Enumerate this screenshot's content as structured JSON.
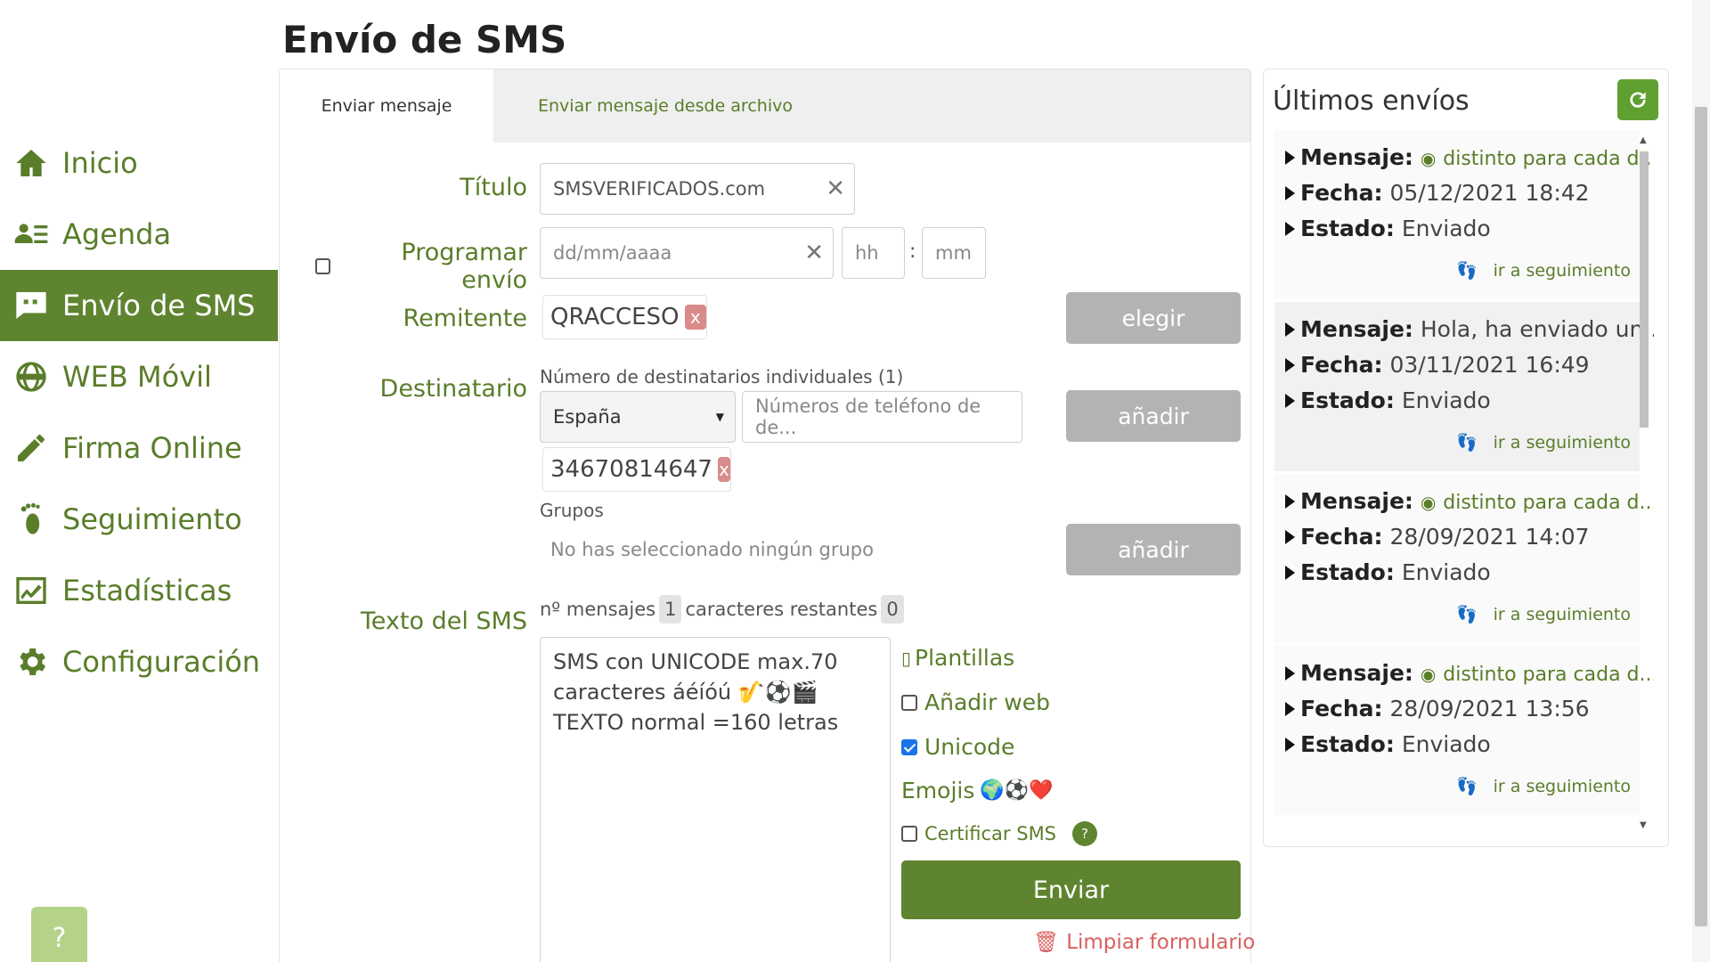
{
  "page_title": "Envío de SMS",
  "sidebar": {
    "items": [
      {
        "label": "Inicio",
        "icon": "home-icon"
      },
      {
        "label": "Agenda",
        "icon": "contacts-icon"
      },
      {
        "label": "Envío de SMS",
        "icon": "chat-icon",
        "active": true
      },
      {
        "label": "WEB Móvil",
        "icon": "globe-icon"
      },
      {
        "label": "Firma Online",
        "icon": "pencil-icon"
      },
      {
        "label": "Seguimiento",
        "icon": "footprint-icon"
      },
      {
        "label": "Estadísticas",
        "icon": "chart-icon"
      },
      {
        "label": "Configuración",
        "icon": "gear-icon"
      }
    ],
    "help_label": "?"
  },
  "tabs": [
    {
      "label": "Enviar mensaje",
      "active": true
    },
    {
      "label": "Enviar mensaje desde archivo",
      "active": false
    }
  ],
  "form": {
    "title_label": "Título",
    "title_value": "SMSVERIFICADOS.com",
    "schedule_label": "Programar envío",
    "date_placeholder": "dd/mm/aaaa",
    "hour_placeholder": "hh",
    "time_sep": ":",
    "minute_placeholder": "mm",
    "sender_label": "Remitente",
    "sender_chip": "QRACCESO",
    "chip_remove": "x",
    "choose_button": "elegir",
    "recipient_label": "Destinatario",
    "individual_count_text": "Número de destinatarios individuales (1)",
    "country_value": "España",
    "phone_placeholder": "Números de teléfono de de...",
    "add_button": "añadir",
    "recipient_chip": "34670814647",
    "groups_label": "Grupos",
    "groups_empty": "No has seleccionado ningún grupo",
    "add_group_button": "añadir",
    "sms_text_label": "Texto del SMS",
    "messages_label": "nº mensajes",
    "messages_count": "1",
    "remaining_label": "caracteres restantes",
    "remaining_count": "0",
    "sms_lines": [
      "SMS con UNICODE max.70",
      "caracteres áéíóú 🎷⚽🎬",
      "TEXTO normal =160 letras"
    ],
    "templates_link": "Plantillas",
    "add_web_label": "Añadir web",
    "unicode_label": "Unicode",
    "unicode_checked": true,
    "emojis_label": "Emojis",
    "emojis": "🌍⚽❤️",
    "certify_label": "Certificar SMS",
    "certify_help": "?",
    "send_button": "Enviar",
    "clear_link": "Limpiar formulario"
  },
  "recent": {
    "title": "Últimos envíos",
    "link_label": "ir a seguimiento",
    "entries": [
      {
        "mensaje_label": "Mensaje:",
        "mensaje": "distinto para cada d...",
        "preview_icon": true,
        "fecha_label": "Fecha:",
        "fecha": "05/12/2021 18:42",
        "estado_label": "Estado:",
        "estado": "Enviado"
      },
      {
        "mensaje_label": "Mensaje:",
        "mensaje": "Hola, ha enviado un...",
        "preview_icon": false,
        "fecha_label": "Fecha:",
        "fecha": "03/11/2021 16:49",
        "estado_label": "Estado:",
        "estado": "Enviado"
      },
      {
        "mensaje_label": "Mensaje:",
        "mensaje": "distinto para cada d...",
        "preview_icon": true,
        "fecha_label": "Fecha:",
        "fecha": "28/09/2021 14:07",
        "estado_label": "Estado:",
        "estado": "Enviado"
      },
      {
        "mensaje_label": "Mensaje:",
        "mensaje": "distinto para cada d...",
        "preview_icon": true,
        "fecha_label": "Fecha:",
        "fecha": "28/09/2021 13:56",
        "estado_label": "Estado:",
        "estado": "Enviado"
      }
    ]
  },
  "colors": {
    "primary": "#5f8430",
    "accent_text": "#5a7d2a",
    "disabled": "#b3b3b3",
    "danger": "#d96060"
  }
}
